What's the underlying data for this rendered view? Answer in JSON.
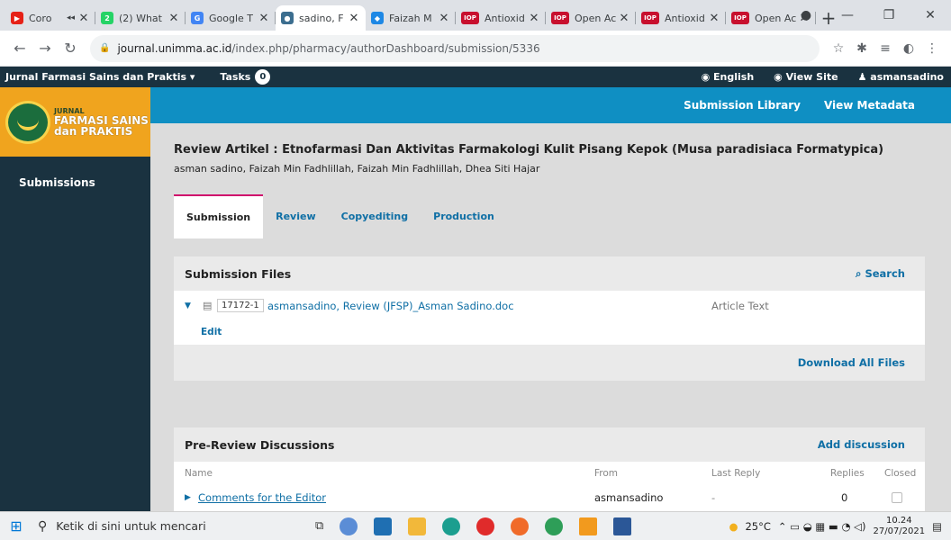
{
  "browser": {
    "tabs": [
      {
        "title": "Coro",
        "color": "#e62117",
        "glyph": "▶",
        "extra": "◂◂"
      },
      {
        "title": "(2) What",
        "color": "#25d366",
        "glyph": "2"
      },
      {
        "title": "Google T",
        "color": "#4285f4",
        "glyph": "G"
      },
      {
        "title": "sadino, F",
        "color": "#3c6e8f",
        "glyph": "●",
        "active": true
      },
      {
        "title": "Faizah M",
        "color": "#1e88e5",
        "glyph": "◆"
      },
      {
        "title": "Antioxid",
        "color": "#c8102e",
        "glyph": "IOP"
      },
      {
        "title": "Open Ac",
        "color": "#c8102e",
        "glyph": "IOP"
      },
      {
        "title": "Antioxid",
        "color": "#c8102e",
        "glyph": "IOP"
      },
      {
        "title": "Open Ac",
        "color": "#c8102e",
        "glyph": "IOP"
      }
    ],
    "new_tab": "+",
    "url_host": "journal.unimma.ac.id",
    "url_path": "/index.php/pharmacy/authorDashboard/submission/5336"
  },
  "topbar": {
    "context": "Jurnal Farmasi Sains dan Praktis",
    "tasks_label": "Tasks",
    "tasks_count": "0",
    "language": "English",
    "view_site": "View Site",
    "user": "asmansadino"
  },
  "logo": {
    "line1": "JURNAL",
    "line2": "FARMASI SAINS",
    "line3": "dan PRAKTIS",
    "seal": "JFSP"
  },
  "sidebar": {
    "submissions": "Submissions"
  },
  "header": {
    "library": "Submission Library",
    "metadata": "View Metadata"
  },
  "submission": {
    "title": "Review Artikel : Etnofarmasi Dan Aktivitas Farmakologi Kulit Pisang Kepok (Musa paradisiaca Formatypica)",
    "authors": "asman sadino, Faizah Min Fadhlillah, Faizah Min Fadhlillah, Dhea Siti Hajar"
  },
  "tabs": [
    "Submission",
    "Review",
    "Copyediting",
    "Production"
  ],
  "files": {
    "heading": "Submission Files",
    "search": "Search",
    "file_id": "17172-1",
    "file_name": "asmansadino, Review (JFSP)_Asman Sadino.doc",
    "file_type": "Article Text",
    "edit": "Edit",
    "download_all": "Download All Files"
  },
  "discussions": {
    "heading": "Pre-Review Discussions",
    "add": "Add discussion",
    "columns": {
      "name": "Name",
      "from": "From",
      "last_reply": "Last Reply",
      "replies": "Replies",
      "closed": "Closed"
    },
    "rows": [
      {
        "name": "Comments for the Editor",
        "from": "asmansadino",
        "last_reply": "-",
        "replies": "0"
      }
    ]
  },
  "taskbar": {
    "search_placeholder": "Ketik di sini untuk mencari",
    "weather": "25°C",
    "time": "10.24",
    "date": "27/07/2021"
  }
}
